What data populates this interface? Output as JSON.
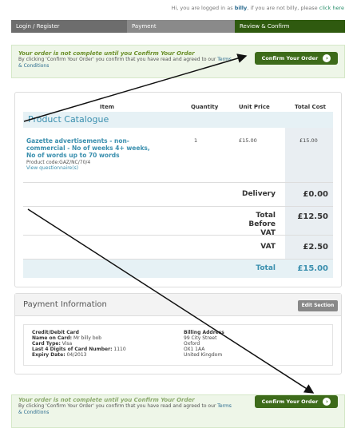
{
  "greeting": {
    "prefix": "Hi, you are logged in as ",
    "user": "billy",
    "suffix": ", if you are not billy, please ",
    "link": "click here"
  },
  "steps": [
    "Login / Register",
    "Payment",
    "Review & Confirm"
  ],
  "notice": {
    "title": "Your order is not complete until you Confirm Your Order",
    "text_prefix": "By clicking 'Confirm Your Order' you confirm that you have read and agreed to our ",
    "terms": "Terms & Conditions",
    "button": "Confirm Your Order",
    "arrow": "›"
  },
  "cart": {
    "headers": {
      "item": "Item",
      "quantity": "Quantity",
      "unit_price": "Unit Price",
      "total_cost": "Total Cost"
    },
    "section": "Product Catalogue",
    "item": {
      "name": "Gazette advertisements - non-commercial - No of weeks 4+ weeks, No of words up to 70 words",
      "code": "Product code:GAZ/NC/70/4",
      "questionnaire": "View questionnaire(s)",
      "quantity": "1",
      "unit_price": "£15.00",
      "total_cost": "£15.00"
    },
    "summary": [
      {
        "label": "Delivery",
        "value": "£0.00"
      },
      {
        "label": "Total Before VAT",
        "value": "£12.50"
      },
      {
        "label": "VAT",
        "value": "£2.50"
      },
      {
        "label": "Total",
        "value": "£15.00"
      }
    ]
  },
  "payment": {
    "title": "Payment Information",
    "edit_button": "Edit Section",
    "card": {
      "heading": "Credit/Debit Card",
      "name_label": "Name on Card:",
      "name": "Mr billy bob",
      "type_label": "Card Type:",
      "type": "Visa",
      "digits_label": "Last 4 Digits of Card Number:",
      "digits": "1110",
      "expiry_label": "Expiry Date:",
      "expiry": "04/2013"
    },
    "billing": {
      "heading": "Billing Address",
      "line1": "99 City Street",
      "line2": "Oxford",
      "line3": "OX1 1AA",
      "line4": "United Kingdom"
    }
  },
  "colors": {
    "active_step": "#2f5a0f",
    "confirm_button": "#3d6b1a",
    "notice_title": "#6b8f2a",
    "link": "#3a8fae"
  }
}
